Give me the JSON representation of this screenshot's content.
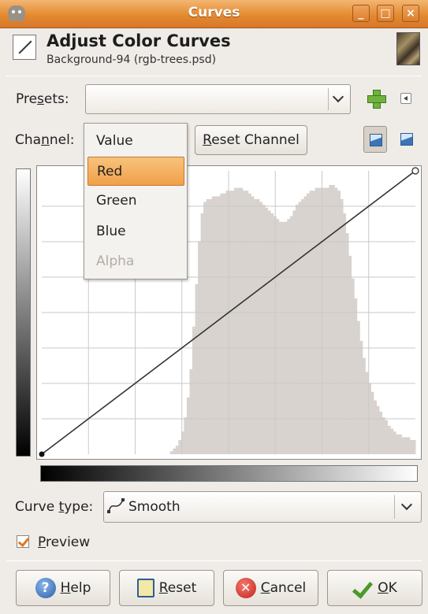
{
  "window": {
    "title": "Curves"
  },
  "header": {
    "title": "Adjust Color Curves",
    "subtitle": "Background-94 (rgb-trees.psd)"
  },
  "presets": {
    "label_pre": "Pre",
    "label_u": "s",
    "label_post": "ets:",
    "value": ""
  },
  "channel": {
    "label_pre": "Cha",
    "label_u": "n",
    "label_post": "nel:",
    "reset_label_pre": "",
    "reset_label_u": "R",
    "reset_label_post": "eset Channel",
    "options": [
      {
        "label": "Value",
        "state": "normal"
      },
      {
        "label": "Red",
        "state": "highlighted"
      },
      {
        "label": "Green",
        "state": "normal"
      },
      {
        "label": "Blue",
        "state": "normal"
      },
      {
        "label": "Alpha",
        "state": "disabled"
      }
    ]
  },
  "curve_type": {
    "label_pre": "Curve ",
    "label_u": "t",
    "label_post": "ype:",
    "value": "Smooth"
  },
  "preview": {
    "label_u": "P",
    "label_post": "review",
    "checked": true
  },
  "buttons": {
    "help": {
      "u": "H",
      "post": "elp"
    },
    "reset": {
      "u": "R",
      "post": "eset"
    },
    "cancel": {
      "u": "C",
      "post": "ancel"
    },
    "ok": {
      "u": "O",
      "post": "K"
    }
  },
  "colors": {
    "accent": "#f0a04a",
    "titlebar": "#e48a2f",
    "histogram": "#d8d3ce",
    "grid": "#c9c9c9"
  },
  "histogram_levels": [
    0,
    0,
    0,
    0,
    0,
    0,
    0,
    0,
    0,
    0,
    0,
    0,
    0,
    0,
    0,
    0,
    0,
    0,
    0,
    0,
    0,
    0,
    0,
    0,
    0,
    0,
    0,
    0,
    0,
    0,
    0,
    0,
    0,
    0,
    0,
    0,
    0,
    0,
    0,
    0,
    0,
    0,
    0,
    0,
    0,
    0,
    0.01,
    0.02,
    0.03,
    0.05,
    0.08,
    0.13,
    0.2,
    0.3,
    0.45,
    0.6,
    0.75,
    0.85,
    0.89,
    0.9,
    0.9,
    0.91,
    0.91,
    0.91,
    0.92,
    0.92,
    0.93,
    0.93,
    0.93,
    0.94,
    0.94,
    0.94,
    0.93,
    0.93,
    0.92,
    0.91,
    0.9,
    0.9,
    0.89,
    0.88,
    0.87,
    0.86,
    0.85,
    0.84,
    0.83,
    0.82,
    0.82,
    0.82,
    0.83,
    0.84,
    0.86,
    0.88,
    0.89,
    0.9,
    0.91,
    0.92,
    0.93,
    0.93,
    0.94,
    0.94,
    0.94,
    0.94,
    0.94,
    0.95,
    0.95,
    0.94,
    0.93,
    0.9,
    0.85,
    0.78,
    0.7,
    0.62,
    0.55,
    0.47,
    0.4,
    0.34,
    0.29,
    0.25,
    0.22,
    0.19,
    0.17,
    0.15,
    0.13,
    0.12,
    0.1,
    0.09,
    0.08,
    0.07,
    0.07,
    0.06,
    0.06,
    0.06,
    0.05,
    0.05
  ],
  "curve": {
    "points": [
      [
        0,
        0
      ],
      [
        255,
        255
      ]
    ]
  }
}
